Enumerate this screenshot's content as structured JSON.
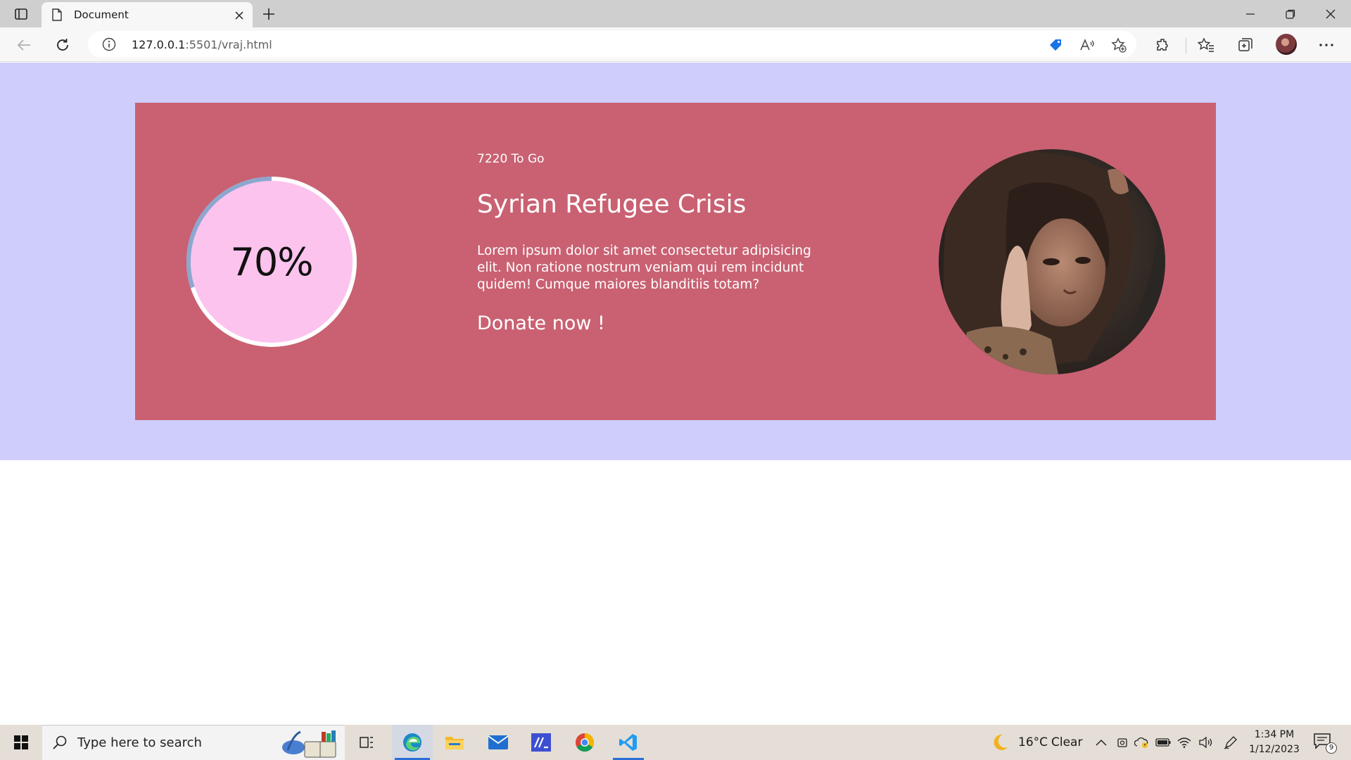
{
  "browser": {
    "tab_title": "Document",
    "url_host": "127.0.0.1",
    "url_path": ":5501/vraj.html"
  },
  "page": {
    "progress_text": "70%",
    "progress_fraction": 0.7,
    "to_go": "7220 To Go",
    "title": "Syrian Refugee Crisis",
    "description": "Lorem ipsum dolor sit amet consectetur adipisicing elit. Non ratione nostrum veniam qui rem incidunt quidem! Cumque maiores blanditiis totam?",
    "cta": "Donate now !"
  },
  "taskbar": {
    "search_placeholder": "Type here to search",
    "weather_temp": "16°C",
    "weather_condition": "Clear",
    "time": "1:34 PM",
    "date": "1/12/2023",
    "notification_count": "9"
  },
  "colors": {
    "page_background": "#cfcdfb",
    "card": "#c96172",
    "progress_fill": "#fcc3ee",
    "progress_track": "#ffffff",
    "progress_arc": "#8da7cf"
  }
}
